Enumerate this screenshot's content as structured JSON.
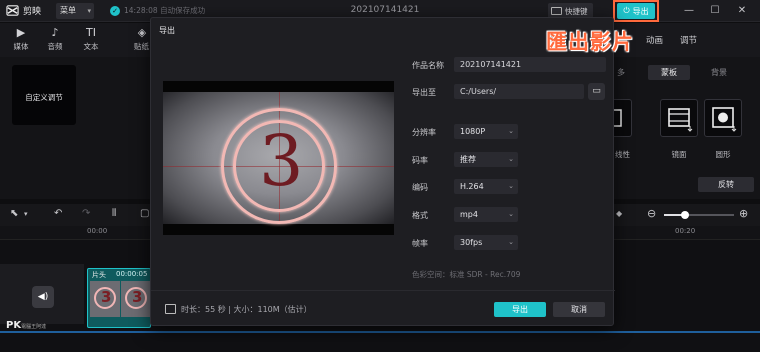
{
  "app": {
    "name": "剪映",
    "menu_label": "菜单",
    "autosave_text": "14:28:08 自动保存成功",
    "window_title": "202107141421",
    "shortcut_label": "快捷键",
    "export_label": "导出"
  },
  "toolbar": {
    "items": [
      {
        "icon": "▶",
        "label": "媒体"
      },
      {
        "icon": "♪",
        "label": "音频"
      },
      {
        "icon": "TI",
        "label": "文本"
      },
      {
        "icon": "◈",
        "label": "贴纸"
      }
    ]
  },
  "media": {
    "preset_card_label": "自定义调节"
  },
  "right_panel": {
    "tabs": [
      "动画",
      "调节"
    ],
    "segments": [
      "多",
      "蒙板",
      "背景"
    ],
    "filters": [
      "线性",
      "镜面",
      "圆形"
    ],
    "reverse_label": "反转"
  },
  "timeline": {
    "ruler": [
      "00:00",
      "00:20"
    ],
    "clip_label": "片头",
    "clip_duration": "00:00:05",
    "thumb_numbers": [
      "3",
      "3"
    ]
  },
  "dialog": {
    "title": "导出",
    "fields": {
      "name_label": "作品名称",
      "name_value": "202107141421",
      "path_label": "导出至",
      "path_value": "C:/Users/",
      "resolution_label": "分辨率",
      "resolution_value": "1080P",
      "bitrate_label": "码率",
      "bitrate_value": "推荐",
      "codec_label": "编码",
      "codec_value": "H.264",
      "format_label": "格式",
      "format_value": "mp4",
      "fps_label": "帧率",
      "fps_value": "30fps"
    },
    "colorspace_text": "色彩空间：标准 SDR - Rec.709",
    "preview_number": "3",
    "footer_info": "时长：55 秒 | 大小：110M（估计）",
    "export_button": "导出",
    "cancel_button": "取消"
  },
  "annotation": {
    "text": "匯出影片"
  },
  "watermark": {
    "text": "PK",
    "sub": "電腦王阿達"
  },
  "colors": {
    "accent": "#1fc2c9",
    "highlight": "#ff6a3d",
    "background": "#0e0e10"
  }
}
